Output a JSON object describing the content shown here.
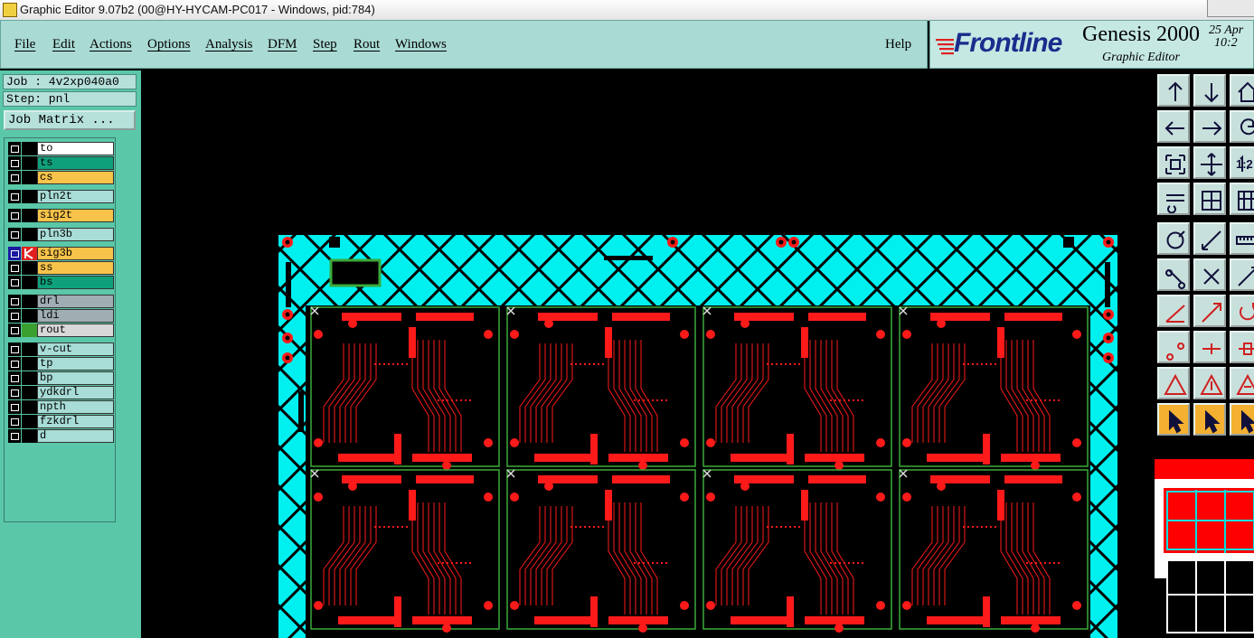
{
  "window": {
    "title": "Graphic Editor 9.07b2 (00@HY-HYCAM-PC017 - Windows, pid:784)"
  },
  "menu": {
    "items": [
      "File",
      "Edit",
      "Actions",
      "Options",
      "Analysis",
      "DFM",
      "Step",
      "Rout",
      "Windows"
    ],
    "help": "Help"
  },
  "brand": {
    "logo": "Frontline",
    "product": "Genesis 2000",
    "subtitle": "Graphic Editor",
    "date": "25 Apr",
    "time": "10:2"
  },
  "job": {
    "job_label": "Job : 4v2xp040a0",
    "step_label": "Step: pnl",
    "matrix_button": "Job Matrix ..."
  },
  "layers": [
    {
      "name": "to",
      "color": "#ffffff"
    },
    {
      "name": "ts",
      "color": "#0ea07a"
    },
    {
      "name": "cs",
      "color": "#f7c34a"
    },
    {
      "name": "pln2t",
      "color": "#a8dcd6"
    },
    {
      "name": "sig2t",
      "color": "#f7c34a"
    },
    {
      "name": "pln3b",
      "color": "#a8dcd6"
    },
    {
      "name": "sig3b",
      "color": "#f7c34a"
    },
    {
      "name": "ss",
      "color": "#f7c34a"
    },
    {
      "name": "bs",
      "color": "#0ea07a"
    },
    {
      "name": "drl",
      "color": "#a0aeb4"
    },
    {
      "name": "ldi",
      "color": "#a0aeb4"
    },
    {
      "name": "rout",
      "color": "#d8d8d8"
    },
    {
      "name": "v-cut",
      "color": "#a8dcd6"
    },
    {
      "name": "tp",
      "color": "#a8dcd6"
    },
    {
      "name": "bp",
      "color": "#a8dcd6"
    },
    {
      "name": "ydkdrl",
      "color": "#a8dcd6"
    },
    {
      "name": "npth",
      "color": "#a8dcd6"
    },
    {
      "name": "fzkdrl",
      "color": "#a8dcd6"
    },
    {
      "name": "d",
      "color": "#a8dcd6"
    }
  ],
  "toolbar": {
    "icons": [
      "pan-up-icon",
      "pan-down-icon",
      "home-icon",
      "pan-left-icon",
      "pan-right-icon",
      "undo-zoom-icon",
      "zoom-fit-icon",
      "zoom-home-icon",
      "zoom-1to1-icon",
      "snap-settings-icon",
      "grid-icon",
      "layout-icon",
      "select-icon",
      "measure-icon",
      "ruler-icon",
      "connect-icon",
      "cross-icon",
      "move-icon",
      "line-icon",
      "arrow-line-icon",
      "rotate-icon",
      "point-icon",
      "split-icon",
      "align-icon",
      "triangle-icon",
      "triangle-outline-icon",
      "triangle-select-icon",
      "pointer-icon",
      "pointer-box-icon",
      "pointer-circle-icon"
    ],
    "ratio_label": "1:2"
  },
  "colors": {
    "panel_bg": "#5ac8a8",
    "menu_bg": "#a9dad3",
    "canvas_bg": "#000000",
    "copper": "#ff1a1a",
    "border_fill": "#00f0f0",
    "outline": "#3aaa3a"
  }
}
